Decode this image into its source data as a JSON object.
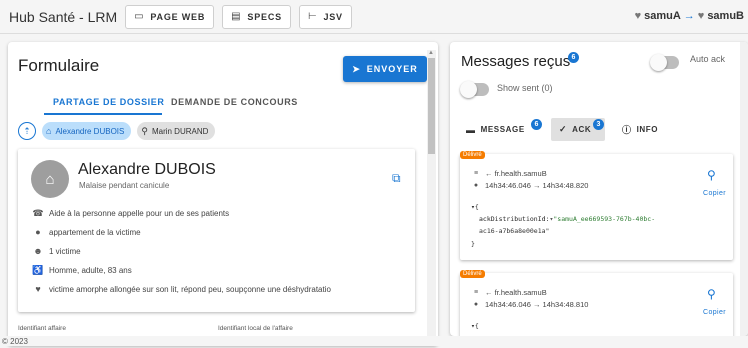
{
  "header": {
    "app_title": "Hub Santé - LRM",
    "buttons": [
      {
        "label": "PAGE WEB",
        "icon": "browser-icon"
      },
      {
        "label": "SPECS",
        "icon": "document-icon"
      },
      {
        "label": "JSV",
        "icon": "tree-icon"
      }
    ],
    "flow": {
      "from": "samuA",
      "arrow": "→",
      "to": "samuB"
    }
  },
  "form": {
    "title": "Formulaire",
    "send_label": "ENVOYER",
    "tabs": [
      "PARTAGE DE DOSSIER",
      "DEMANDE DE CONCOURS"
    ],
    "chips": [
      {
        "label": "Alexandre DUBOIS",
        "active": true,
        "icon": "house-icon"
      },
      {
        "label": "Marin DURAND",
        "active": false,
        "icon": "bike-icon"
      }
    ],
    "patient": {
      "name": "Alexandre DUBOIS",
      "subtitle": "Malaise pendant canicule",
      "details": [
        {
          "icon": "phone-icon",
          "text": "Aide à la personne appelle pour un de ses patients"
        },
        {
          "icon": "location-pin-icon",
          "text": "appartement de la victime"
        },
        {
          "icon": "people-icon",
          "text": "1 victime"
        },
        {
          "icon": "person-cane-icon",
          "text": "Homme, adulte, 83 ans"
        },
        {
          "icon": "heart-pulse-icon",
          "text": "victime amorphe allongée sur son lit, répond peu, soupçonne une déshydratatio"
        }
      ]
    },
    "field_labels": [
      "Identifiant affaire",
      "Identifiant local de l'affaire"
    ]
  },
  "footer": {
    "text": "© 2023"
  },
  "messages": {
    "title": "Messages reçus",
    "count": "6",
    "auto_ack_label": "Auto ack",
    "show_sent_label": "Show sent (0)",
    "tabs": [
      {
        "label": "MESSAGE",
        "badge": "6",
        "icon": "message-icon"
      },
      {
        "label": "ACK",
        "badge": "3",
        "icon": "check-icon"
      },
      {
        "label": "INFO",
        "badge": "",
        "icon": "info-icon"
      }
    ],
    "items": [
      {
        "status": "Délivré",
        "route": "← fr.health.samuB",
        "time": "14h34:46.046 → 14h34:48.820",
        "copy_label": "Copier",
        "json_open": "▾{",
        "json_key": "ackDistributionId:",
        "json_caret": "▾",
        "json_value_1": "\"samuA_ee669593-767b-40bc-",
        "json_value_2": "ac16-a7b6a8e00e1a\"",
        "json_close": "}"
      },
      {
        "status": "Délivré",
        "route": "← fr.health.samuB",
        "time": "14h34:46.046 → 14h34:48.810",
        "copy_label": "Copier",
        "json_open": "▾{"
      }
    ]
  },
  "colors": {
    "primary": "#1976d2",
    "status": "#f57c00",
    "chip_active": "#bbdefb"
  }
}
